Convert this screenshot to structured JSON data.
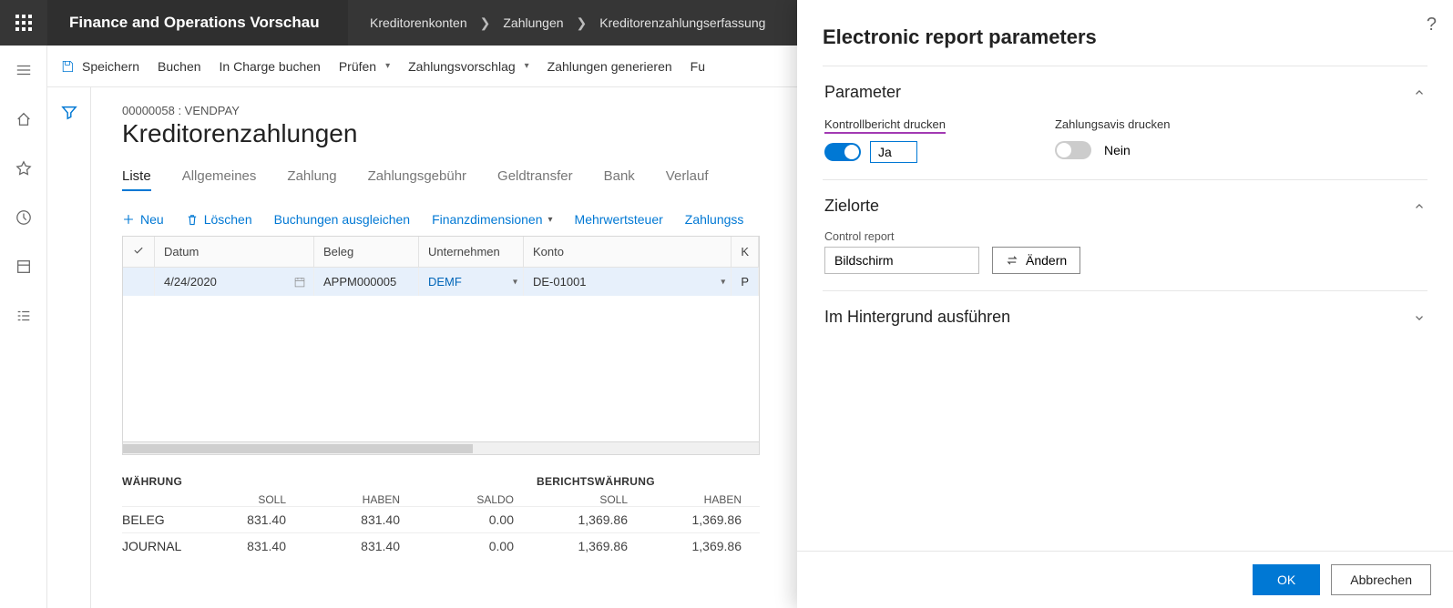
{
  "header": {
    "app_title": "Finance and Operations Vorschau",
    "crumbs": [
      "Kreditorenkonten",
      "Zahlungen",
      "Kreditorenzahlungserfassung"
    ]
  },
  "cmdbar": {
    "save": "Speichern",
    "post": "Buchen",
    "post_batch": "In Charge buchen",
    "validate": "Prüfen",
    "proposal": "Zahlungsvorschlag",
    "generate": "Zahlungen generieren",
    "fu": "Fu"
  },
  "page": {
    "journal_id": "00000058 : VENDPAY",
    "title": "Kreditorenzahlungen",
    "tabs": [
      "Liste",
      "Allgemeines",
      "Zahlung",
      "Zahlungsgebühr",
      "Geldtransfer",
      "Bank",
      "Verlauf"
    ],
    "active_tab": "Liste"
  },
  "gridcmd": {
    "new": "Neu",
    "delete": "Löschen",
    "settle": "Buchungen ausgleichen",
    "dims": "Finanzdimensionen",
    "tax": "Mehrwertsteuer",
    "status": "Zahlungss"
  },
  "grid": {
    "columns": [
      "Datum",
      "Beleg",
      "Unternehmen",
      "Konto",
      "K"
    ],
    "rows": [
      {
        "date": "4/24/2020",
        "voucher": "APPM000005",
        "company": "DEMF",
        "account": "DE-01001",
        "k": "P"
      }
    ]
  },
  "totals": {
    "sec1": "WÄHRUNG",
    "sec2": "BERICHTSWÄHRUNG",
    "cols": [
      "SOLL",
      "HABEN",
      "SALDO",
      "SOLL",
      "HABEN"
    ],
    "rows": [
      {
        "label": "BELEG",
        "v": [
          "831.40",
          "831.40",
          "0.00",
          "1,369.86",
          "1,369.86"
        ]
      },
      {
        "label": "JOURNAL",
        "v": [
          "831.40",
          "831.40",
          "0.00",
          "1,369.86",
          "1,369.86"
        ]
      }
    ]
  },
  "panel": {
    "title": "Electronic report parameters",
    "sec_param": "Parameter",
    "sec_dest": "Zielorte",
    "sec_bg": "Im Hintergrund ausführen",
    "field_controlreport": "Kontrollbericht drucken",
    "field_controlreport_val": "Ja",
    "field_advice": "Zahlungsavis drucken",
    "field_advice_val": "Nein",
    "dest_label": "Control report",
    "dest_value": "Bildschirm",
    "change_btn": "Ändern",
    "ok": "OK",
    "cancel": "Abbrechen"
  }
}
